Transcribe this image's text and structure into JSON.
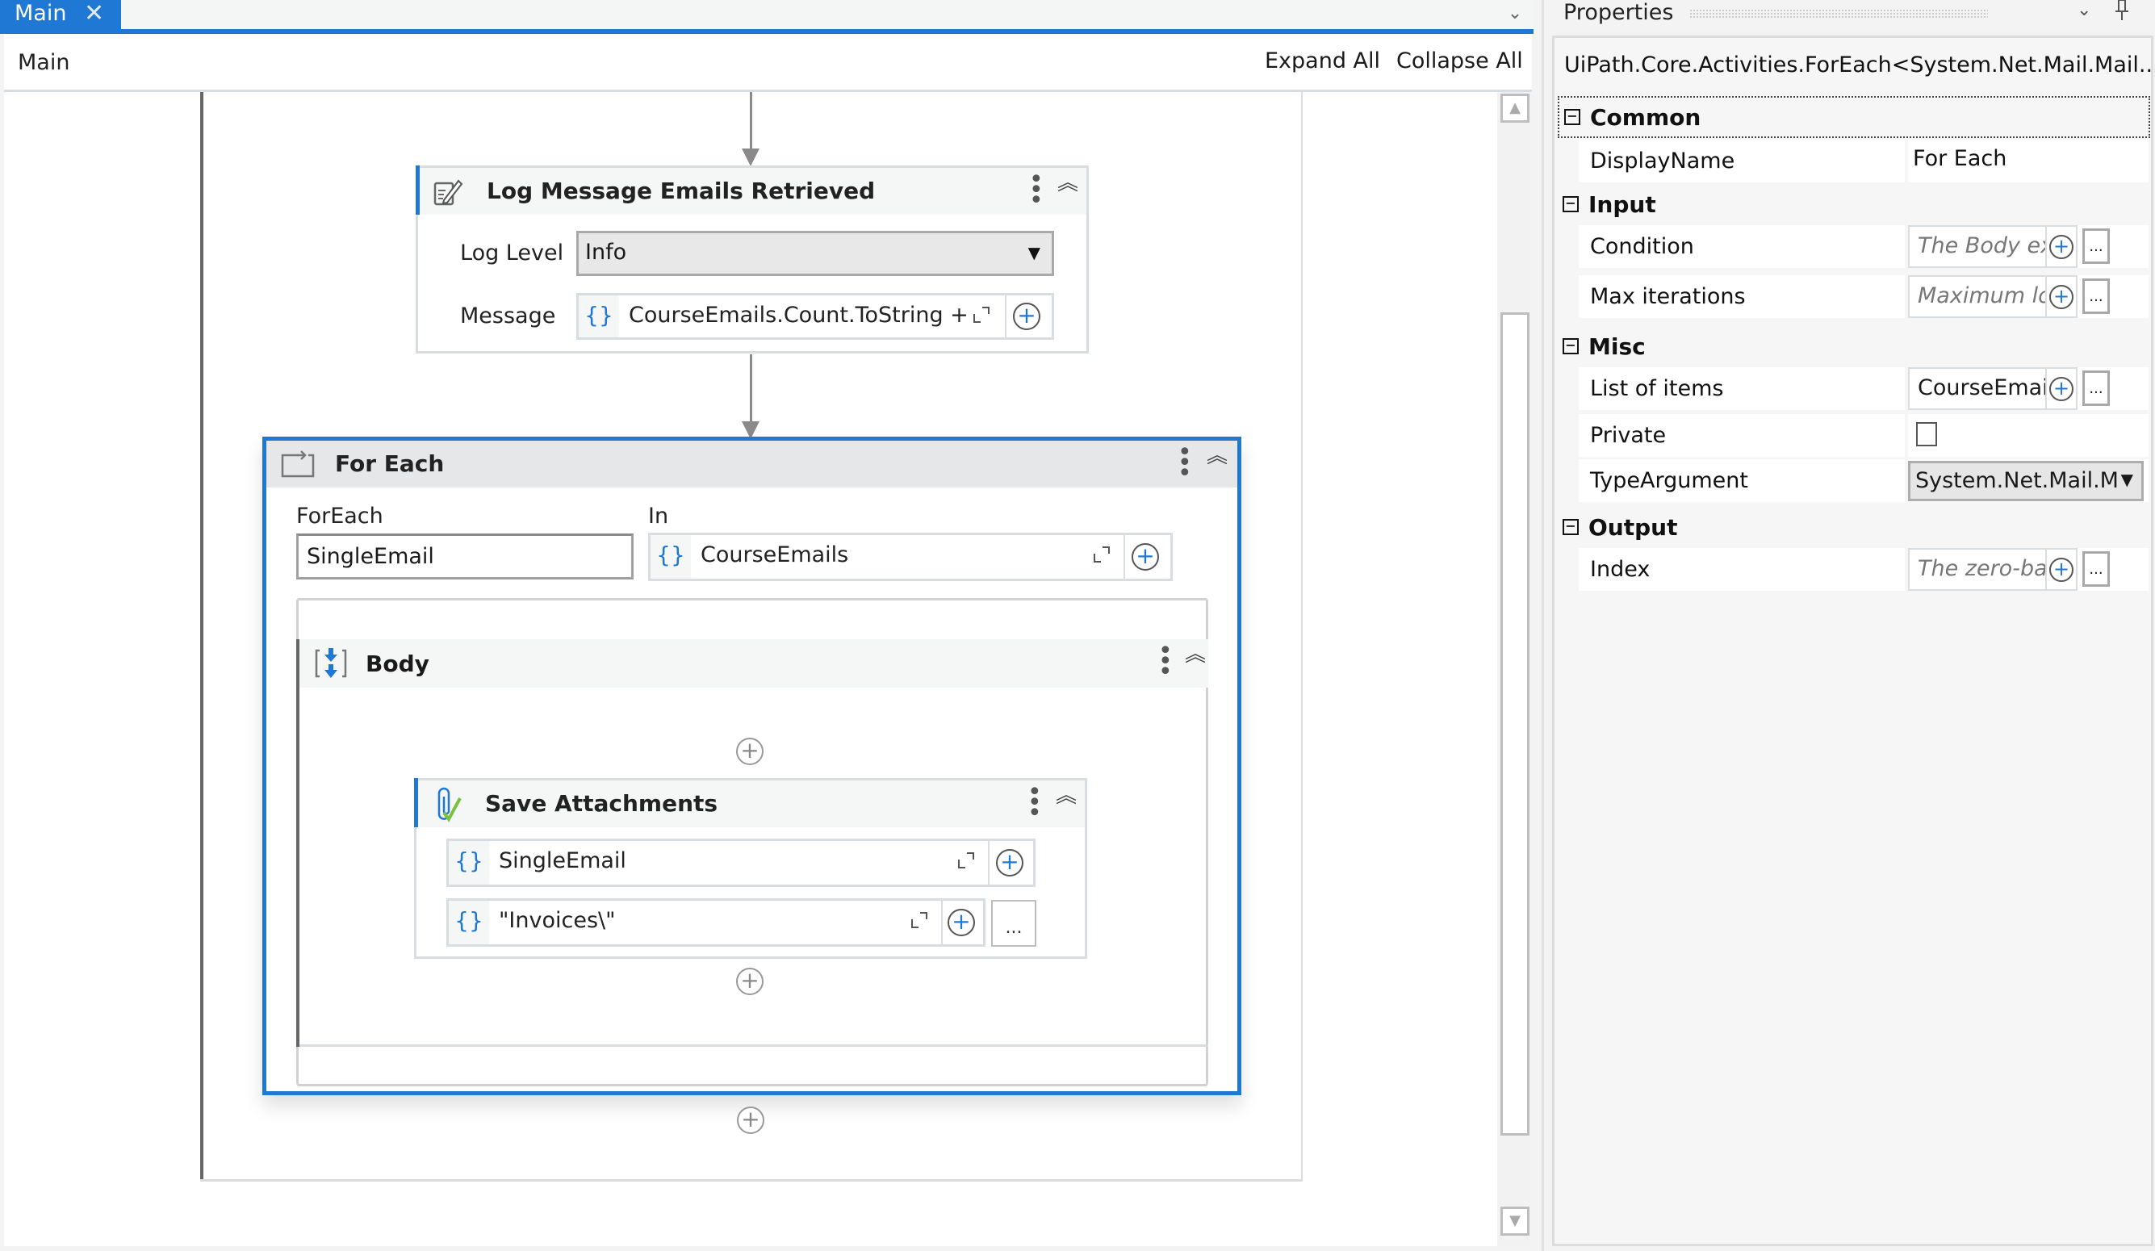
{
  "tab": {
    "label": "Main",
    "close_glyph": "✕"
  },
  "header": {
    "breadcrumb": "Main",
    "expand_all": "Expand All",
    "collapse_all": "Collapse All"
  },
  "icons": {
    "tab_overflow": "⌄",
    "kebab": "⋮",
    "collapse": "︽",
    "add": "+",
    "ellipsis": "...",
    "dropdown": "▼",
    "scroll_up": "▲",
    "scroll_down": "▼",
    "braces": "{}",
    "pin": "📌"
  },
  "activities": {
    "log_message": {
      "title": "Log Message Emails Retrieved",
      "log_level_label": "Log Level",
      "log_level_value": "Info",
      "message_label": "Message",
      "message_value": "CourseEmails.Count.ToString  +"
    },
    "for_each": {
      "title": "For Each",
      "foreach_label": "ForEach",
      "foreach_value": "SingleEmail",
      "in_label": "In",
      "in_value": "CourseEmails",
      "body": {
        "title": "Body",
        "save_attachments": {
          "title": "Save Attachments",
          "message_value": "SingleEmail",
          "folder_value": "\"Invoices\\\""
        }
      }
    }
  },
  "properties": {
    "panel_title": "Properties",
    "activity_type": "UiPath.Core.Activities.ForEach<System.Net.Mail.Mail...",
    "categories": [
      {
        "name": "Common",
        "rows": [
          {
            "name": "DisplayName",
            "value": "For Each"
          }
        ]
      },
      {
        "name": "Input",
        "rows": [
          {
            "name": "Condition",
            "placeholder": "The Body ex"
          },
          {
            "name": "Max iterations",
            "placeholder": "Maximum lo"
          }
        ]
      },
      {
        "name": "Misc",
        "rows": [
          {
            "name": "List of items",
            "value": "CourseEmai"
          },
          {
            "name": "Private",
            "checked": false
          },
          {
            "name": "TypeArgument",
            "value": "System.Net.Mail.M"
          }
        ]
      },
      {
        "name": "Output",
        "rows": [
          {
            "name": "Index",
            "placeholder": "The zero-ba"
          }
        ]
      }
    ]
  },
  "colors": {
    "accent": "#1e78d4",
    "selection_border": "#1e78d4",
    "checkmark_green": "#7ac143"
  }
}
